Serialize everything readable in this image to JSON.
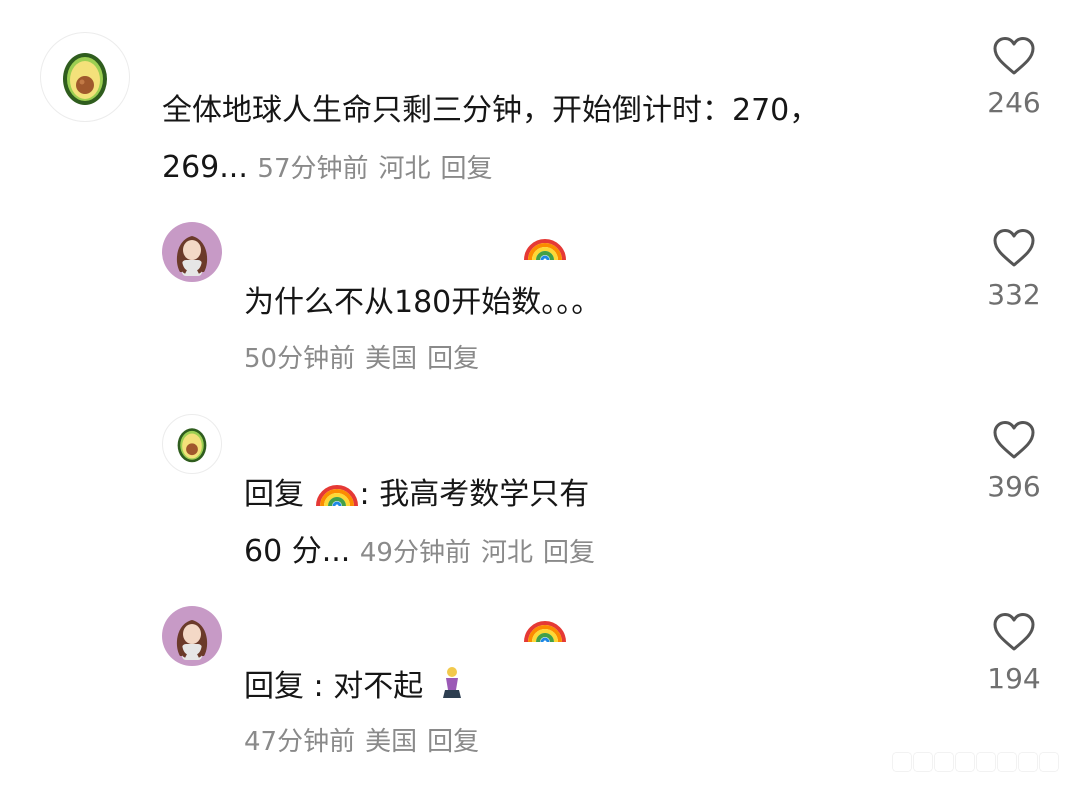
{
  "comments": [
    {
      "text_line1": "全体地球人生命只剩三分钟，开始倒计时：270，",
      "text_line2": "269...",
      "time": "57分钟前",
      "location": "河北",
      "reply": "回复",
      "likes": "246",
      "avatar": "avocado-icon"
    },
    {
      "text_line1": "为什么不从180开始数。。。",
      "time": "50分钟前",
      "location": "美国",
      "reply": "回复",
      "likes": "332",
      "avatar": "girl-avatar"
    },
    {
      "reply_prefix": "回复",
      "text_line1_suffix": ": 我高考数学只有",
      "text_line2": "60 分...",
      "time": "49分钟前",
      "location": "河北",
      "reply": "回复",
      "likes": "396",
      "avatar": "avocado-icon"
    },
    {
      "reply_prefix": "回复",
      "text_line1_suffix": ": 对不起",
      "time": "47分钟前",
      "location": "美国",
      "reply": "回复",
      "likes": "194",
      "avatar": "girl-avatar"
    }
  ],
  "icons": {
    "like": "heart-outline-icon",
    "rainbow": "rainbow-emoji-icon",
    "kneel": "kneeling-person-emoji-icon"
  },
  "colors": {
    "text": "#161616",
    "meta": "#8a8a8a",
    "avatar_purple": "#c79ac6",
    "avocado_green": "#7cc142"
  }
}
